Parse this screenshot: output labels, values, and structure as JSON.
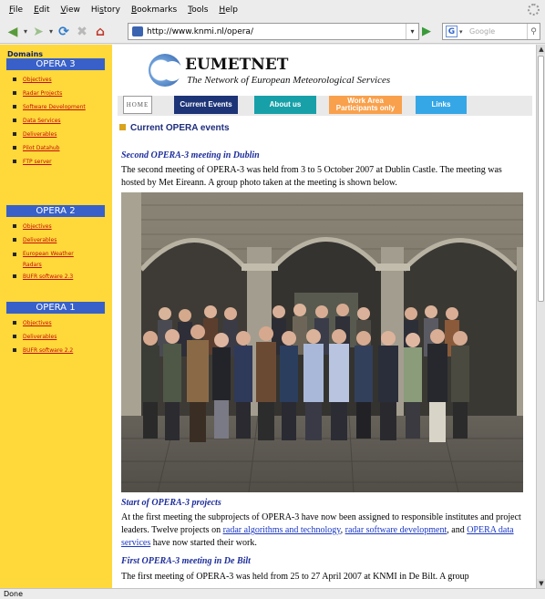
{
  "menubar": {
    "items": [
      "File",
      "Edit",
      "View",
      "History",
      "Bookmarks",
      "Tools",
      "Help"
    ],
    "shortcuts": [
      "F",
      "E",
      "V",
      "s",
      "B",
      "T",
      "H"
    ]
  },
  "toolbar": {
    "url": "http://www.knmi.nl/opera/",
    "search_placeholder": "Google",
    "search_engine_label": "G"
  },
  "sidebar": {
    "title": "Domains",
    "groups": [
      {
        "heading": "OPERA 3",
        "links": [
          "Objectives",
          "Radar Projects",
          "Software Development",
          "Data Services",
          "Deliverables",
          "Pilot Datahub",
          "FTP server"
        ]
      },
      {
        "heading": "OPERA 2",
        "links": [
          "Objectives",
          "Deliverables",
          "European Weather Radars",
          "BUFR software 2.3"
        ]
      },
      {
        "heading": "OPERA 1",
        "links": [
          "Objectives",
          "Deliverables",
          "BUFR software 2.2"
        ]
      }
    ]
  },
  "header": {
    "logo_title": "EUMETNET",
    "logo_subtitle": "The Network of European Meteorological Services"
  },
  "tabs": {
    "home": "HOME",
    "current_events": "Current Events",
    "about_us": "About us",
    "work_area": "Work Area Participants only",
    "links": "Links"
  },
  "main": {
    "section_heading": "Current OPERA events",
    "articles": [
      {
        "title": "Second OPERA-3 meeting in Dublin",
        "text": "The second meeting of OPERA-3 was held from 3 to 5 October 2007 at Dublin Castle. The meeting was hosted by Met Eireann. A group photo taken at the meeting is shown below."
      },
      {
        "title": "Start of OPERA-3 projects",
        "text_before": "At the first meeting the subprojects of OPERA-3 have now been assigned to responsible institutes and project leaders. Twelve projects on ",
        "link1": "radar algorithms and technology",
        "text_mid1": ", ",
        "link2": "radar software development",
        "text_mid2": ", and ",
        "link3": "OPERA data services",
        "text_after": " have now started their work."
      },
      {
        "title": "First OPERA-3 meeting in De Bilt",
        "text": "The first meeting of OPERA-3 was held from 25 to 27 April 2007 at KNMI in De Bilt. A group"
      }
    ]
  },
  "status": {
    "text": "Done"
  }
}
